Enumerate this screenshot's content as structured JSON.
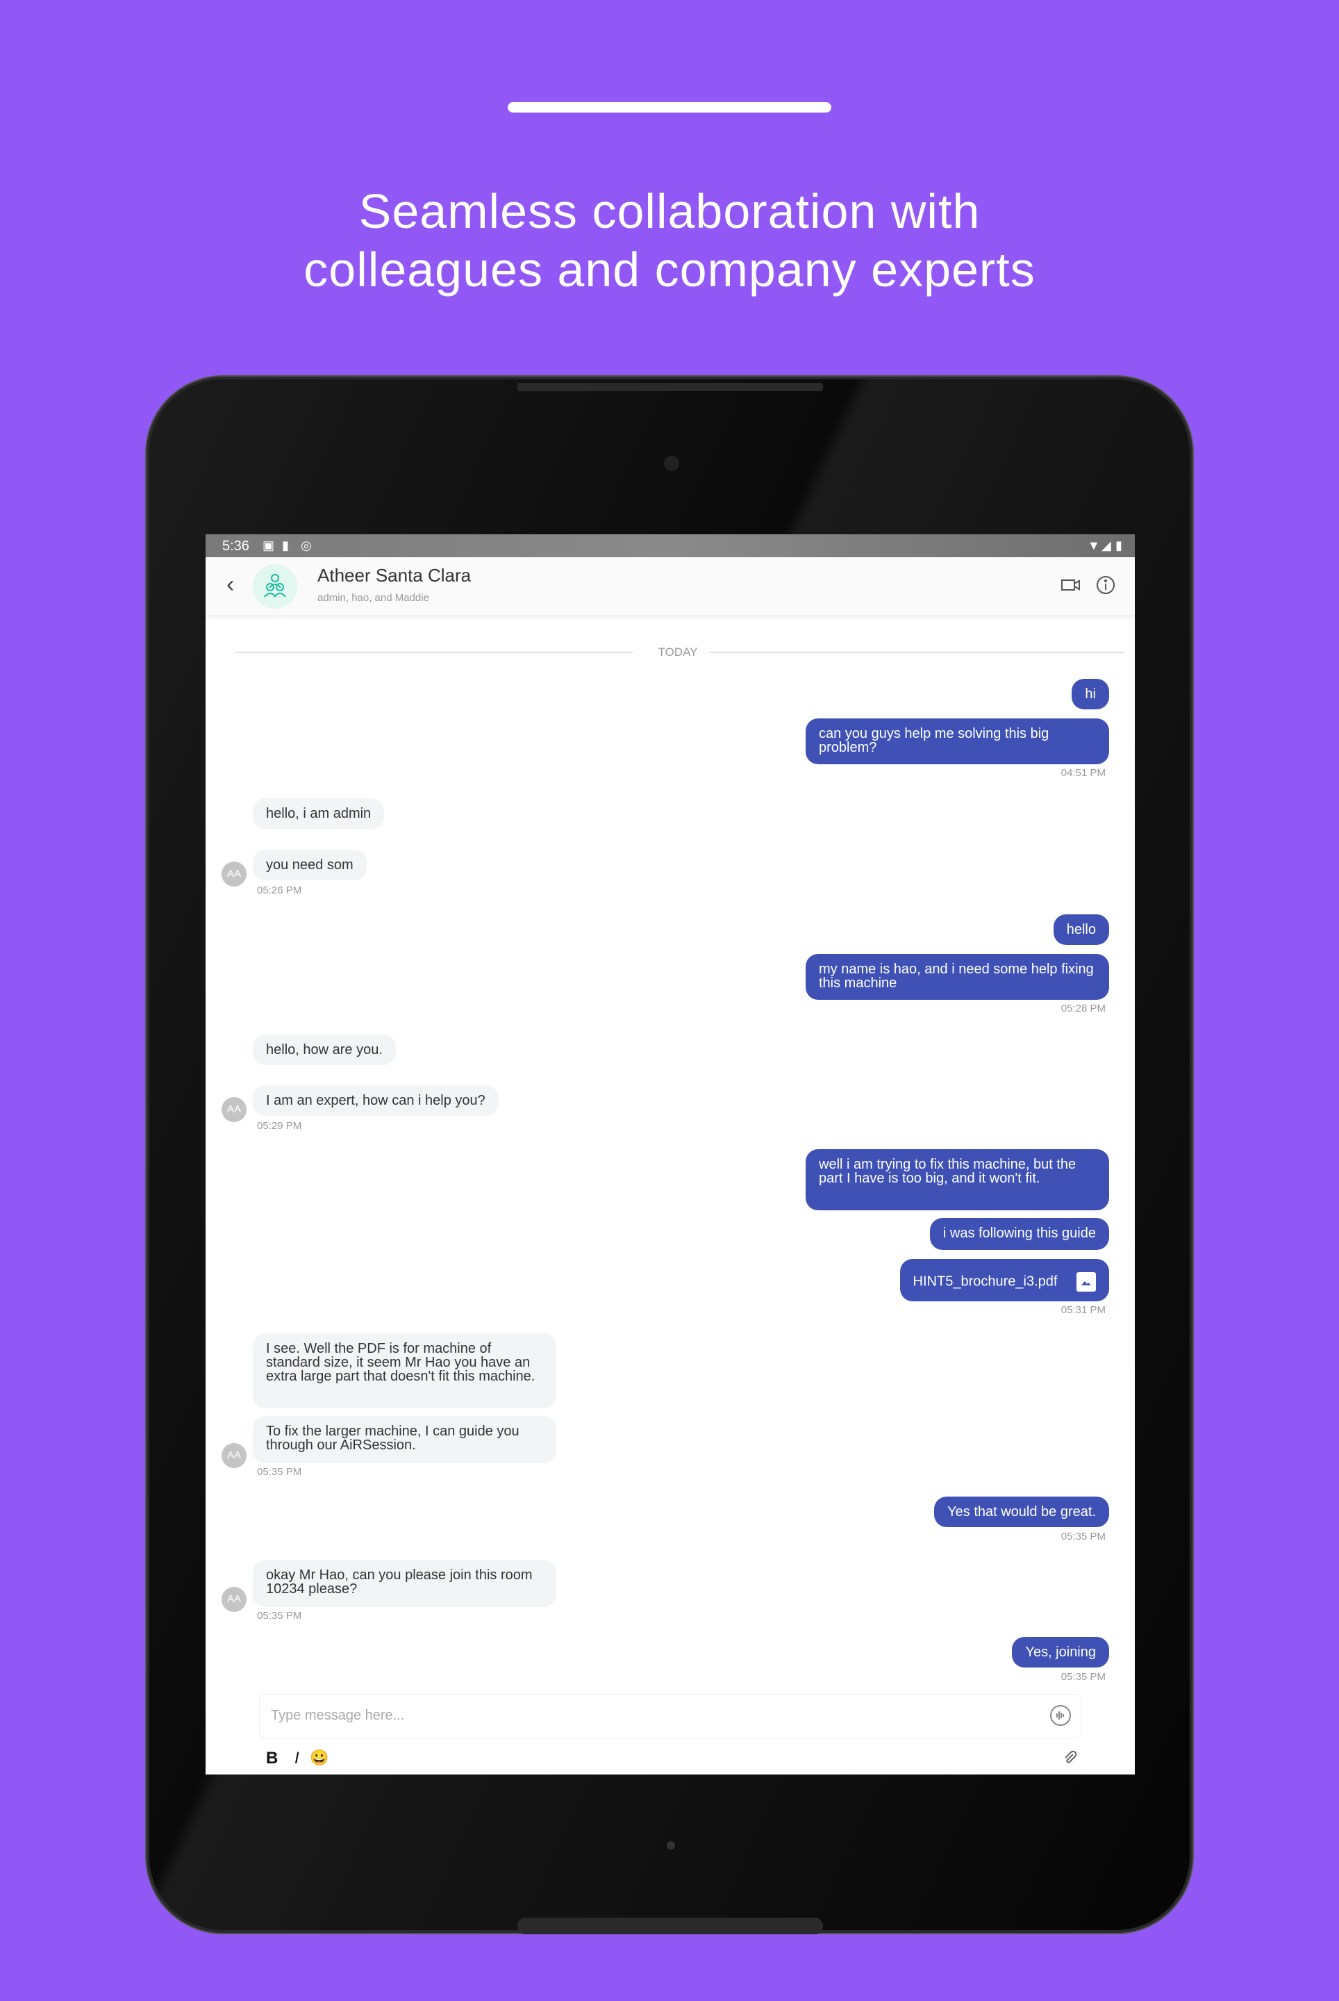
{
  "promo": {
    "line1": "Seamless collaboration with",
    "line2": "colleagues and company experts"
  },
  "colors": {
    "background": "#9158f5",
    "outgoing_bubble": "#3f51b5",
    "incoming_bubble": "#f3f4f6",
    "group_avatar": "#1abc9c"
  },
  "status_bar": {
    "time": "5:36",
    "icons": [
      "a-icon",
      "sd-card-icon",
      "sync-icon",
      "wifi-icon",
      "signal-icon",
      "battery-icon"
    ]
  },
  "header": {
    "title": "Atheer Santa Clara",
    "subtitle": "admin, hao, and Maddie",
    "icons": [
      "back-icon",
      "group-icon",
      "video-call-icon",
      "info-icon"
    ]
  },
  "chat": {
    "date_divider": "TODAY",
    "messages": [
      {
        "dir": "out",
        "text": "hi"
      },
      {
        "dir": "out",
        "text": "can you guys help me solving this big problem?",
        "time": "04:51 PM"
      },
      {
        "dir": "in",
        "text": "hello, i am admin"
      },
      {
        "dir": "in",
        "text": "you need som",
        "avatar": "AA",
        "time": "05:26 PM"
      },
      {
        "dir": "out",
        "text": "hello"
      },
      {
        "dir": "out",
        "text": "my name is hao, and i need some help fixing this machine",
        "time": "05:28 PM"
      },
      {
        "dir": "in",
        "text": "hello, how are you."
      },
      {
        "dir": "in",
        "text": "I am an expert, how can i help you?",
        "avatar": "AA",
        "time": "05:29 PM"
      },
      {
        "dir": "out",
        "text": "well i am trying to fix this machine, but the part I have is too big, and it won't fit."
      },
      {
        "dir": "out",
        "text": "i was following this guide"
      },
      {
        "dir": "out",
        "text": "HINT5_brochure_i3.pdf",
        "time": "05:31 PM"
      },
      {
        "dir": "in",
        "text": "I see. Well the PDF is for machine of standard size, it seem Mr Hao you have an extra large part that doesn't fit this machine."
      },
      {
        "dir": "in",
        "text": "To fix the larger machine, I can guide you through our AiRSession.",
        "avatar": "AA",
        "time": "05:35 PM"
      },
      {
        "dir": "out",
        "text": "Yes that would be great.",
        "time": "05:35 PM"
      },
      {
        "dir": "in",
        "text": "okay Mr Hao, can you please join this room 10234 please?",
        "avatar": "AA",
        "time": "05:35 PM"
      },
      {
        "dir": "out",
        "text": "Yes, joining",
        "time": "05:35 PM"
      }
    ]
  },
  "composer": {
    "placeholder": "Type message here...",
    "bold": "B",
    "italic": "I",
    "emoji": "😀"
  }
}
